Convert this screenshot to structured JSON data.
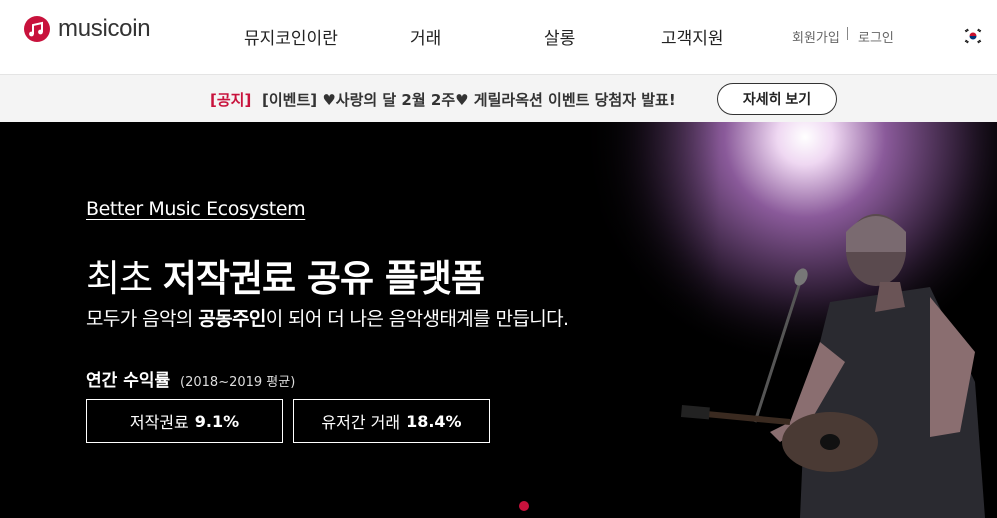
{
  "brand": {
    "logo_text": "musicoin",
    "accent": "#c8123c"
  },
  "nav": {
    "items": [
      "뮤지코인이란",
      "거래",
      "살롱",
      "고객지원"
    ],
    "signup": "회원가입",
    "login": "로그인",
    "language_flag": "korea-flag-icon"
  },
  "notice": {
    "tag": "[공지]",
    "text": "[이벤트] ♥사랑의 달 2월 2주♥ 게릴라옥션 이벤트 당첨자 발표!",
    "button": "자세히 보기"
  },
  "hero": {
    "eyebrow": "Better Music Ecosystem",
    "headline_light": "최초",
    "headline_bold": "저작권료 공유 플랫폼",
    "sub_pre": "모두가 음악의",
    "sub_bold": "공동주인",
    "sub_post": "이 되어 더 나은 음악생태계를 만듭니다.",
    "yield_label": "연간 수익률",
    "yield_note": "(2018~2019 평균)",
    "stats": [
      {
        "label": "저작권료",
        "value": "9.1%"
      },
      {
        "label": "유저간 거래",
        "value": "18.4%"
      }
    ],
    "slide_indicator_color": "#c8123c"
  }
}
